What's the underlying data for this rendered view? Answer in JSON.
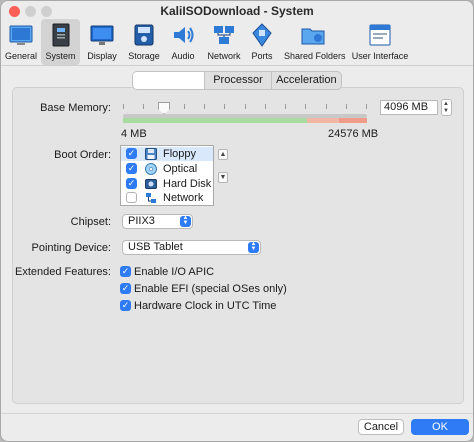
{
  "window": {
    "title": "KaliISODownload - System"
  },
  "toolbar": {
    "items": [
      {
        "label": "General",
        "icon": "general-icon"
      },
      {
        "label": "System",
        "icon": "system-icon"
      },
      {
        "label": "Display",
        "icon": "display-icon"
      },
      {
        "label": "Storage",
        "icon": "storage-icon"
      },
      {
        "label": "Audio",
        "icon": "audio-icon"
      },
      {
        "label": "Network",
        "icon": "network-icon"
      },
      {
        "label": "Ports",
        "icon": "ports-icon"
      },
      {
        "label": "Shared Folders",
        "icon": "shared-folders-icon"
      },
      {
        "label": "User Interface",
        "icon": "user-interface-icon"
      }
    ],
    "selected": "System"
  },
  "tabs": [
    {
      "label": ""
    },
    {
      "label": "Processor"
    },
    {
      "label": "Acceleration"
    }
  ],
  "base_memory": {
    "label": "Base Memory:",
    "value": "4096 MB",
    "min_label": "4 MB",
    "max_label": "24576 MB",
    "slider_fraction": 0.167
  },
  "boot_order": {
    "label": "Boot Order:",
    "items": [
      {
        "name": "Floppy",
        "checked": true,
        "icon": "floppy-icon"
      },
      {
        "name": "Optical",
        "checked": true,
        "icon": "optical-icon"
      },
      {
        "name": "Hard Disk",
        "checked": true,
        "icon": "hard-disk-icon"
      },
      {
        "name": "Network",
        "checked": false,
        "icon": "network-icon"
      }
    ]
  },
  "chipset": {
    "label": "Chipset:",
    "value": "PIIX3"
  },
  "pointing_device": {
    "label": "Pointing Device:",
    "value": "USB Tablet"
  },
  "extended_features": {
    "label": "Extended Features:",
    "items": [
      {
        "label": "Enable I/O APIC",
        "checked": true
      },
      {
        "label": "Enable EFI (special OSes only)",
        "checked": true
      },
      {
        "label": "Hardware Clock in UTC Time",
        "checked": true
      }
    ]
  },
  "buttons": {
    "cancel": "Cancel",
    "ok": "OK"
  },
  "colors": {
    "accent": "#2f7bf5",
    "zone_ok": "#a9dca0",
    "zone_warn": "#f2b6a4",
    "zone_bad": "#ef9c88"
  }
}
